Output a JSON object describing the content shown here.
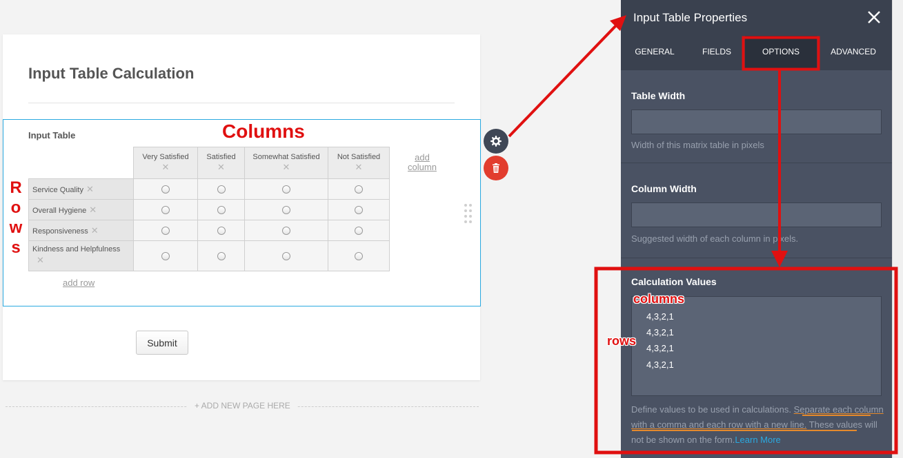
{
  "form": {
    "title": "Input Table Calculation",
    "field_label": "Input Table",
    "columns": [
      "Very Satisfied",
      "Satisfied",
      "Somewhat Satisfied",
      "Not Satisfied"
    ],
    "rows": [
      "Service Quality",
      "Overall Hygiene",
      "Responsiveness",
      "Kindness and Helpfulness"
    ],
    "add_column_label": "add column",
    "add_row_label": "add row",
    "submit_label": "Submit",
    "remove_glyph": "✕",
    "add_page_label": "+ ADD NEW PAGE HERE"
  },
  "annotations": {
    "columns_label": "Columns",
    "rows_letters": [
      "R",
      "o",
      "w",
      "s"
    ],
    "panel_columns_label": "columns",
    "panel_rows_label": "rows"
  },
  "panel": {
    "title": "Input Table Properties",
    "tabs": [
      "GENERAL",
      "FIELDS",
      "OPTIONS",
      "ADVANCED"
    ],
    "active_tab": "OPTIONS",
    "table_width": {
      "label": "Table Width",
      "value": "",
      "help": "Width of this matrix table in pixels"
    },
    "column_width": {
      "label": "Column Width",
      "value": "",
      "help": "Suggested width of each column in pixels."
    },
    "calculation": {
      "label": "Calculation Values",
      "lines": [
        "4,3,2,1",
        "4,3,2,1",
        "4,3,2,1",
        "4,3,2,1"
      ],
      "help_pre": "Define values to be used in calculations. ",
      "help_underlined": "Separate each column with a comma and each row with a new line.",
      "help_post": " These values will not be shown on the form.",
      "learn_more": "Learn More"
    }
  },
  "icons": {
    "gear_button": "gear-icon",
    "delete_button": "trash-icon",
    "close": "close-icon",
    "drag": "drag-handle-icon"
  },
  "colors": {
    "accent_blue": "#2aa9e0",
    "panel_bg": "#4a5263",
    "panel_dark": "#3a414f",
    "annotation_red": "#e01010",
    "delete_red": "#e23d2e"
  }
}
